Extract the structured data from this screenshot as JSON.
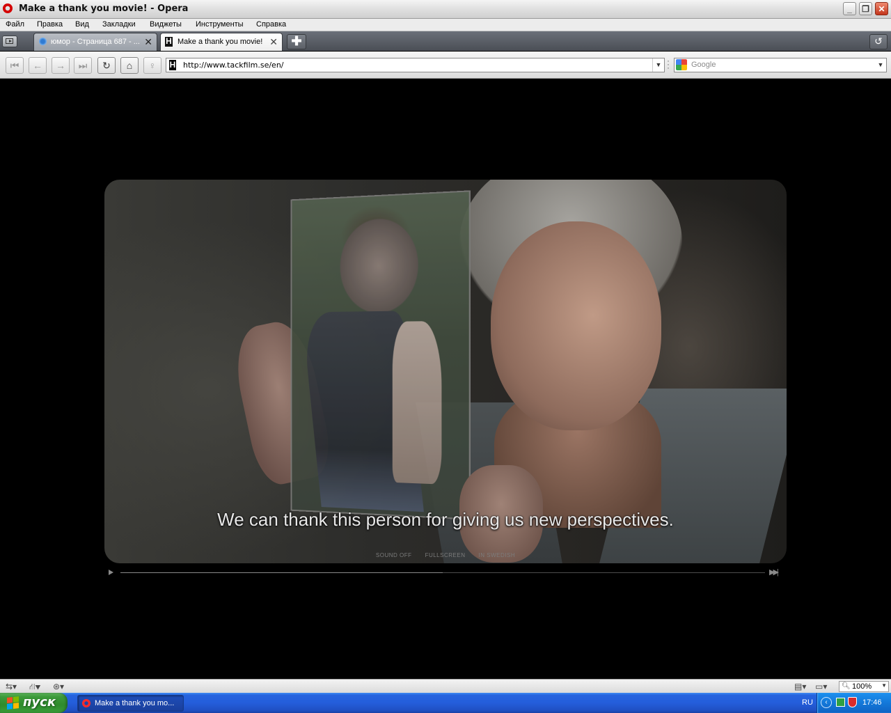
{
  "window": {
    "title": "Make a thank you movie! - Opera",
    "minimize_glyph": "_",
    "restore_glyph": "❐",
    "close_glyph": "✕"
  },
  "menu": {
    "items": [
      "Файл",
      "Правка",
      "Вид",
      "Закладки",
      "Виджеты",
      "Инструменты",
      "Справка"
    ]
  },
  "tabs": [
    {
      "label": "юмор - Страница 687 - ...",
      "icon": "globe-icon",
      "active": false
    },
    {
      "label": "Make a thank you movie!",
      "icon": "site-h-icon",
      "active": true
    }
  ],
  "toolbar": {
    "new_tab_glyph": "✚",
    "closed_tabs_glyph": "↺",
    "nav_glyphs": {
      "rewind": "⏮",
      "back": "←",
      "forward": "→",
      "fast_forward": "⏭",
      "reload": "↻",
      "home": "⌂",
      "wand": "♀"
    }
  },
  "address": {
    "url": "http://www.tackfilm.se/en/",
    "search_placeholder": "Google"
  },
  "video": {
    "subtitle": "We can thank this person for giving us new perspectives.",
    "options": [
      "SOUND OFF",
      "FULLSCREEN",
      "IN SWEDISH"
    ],
    "progress": 0.5
  },
  "statusbar": {
    "zoom": "100%"
  },
  "taskbar": {
    "start_label": "пуск",
    "task_label": "Make a thank you mo...",
    "language": "RU",
    "clock": "17:46"
  },
  "colors": {
    "taskbar_blue": "#245edb",
    "start_green": "#3c9a3a",
    "opera_red": "#d40000"
  }
}
